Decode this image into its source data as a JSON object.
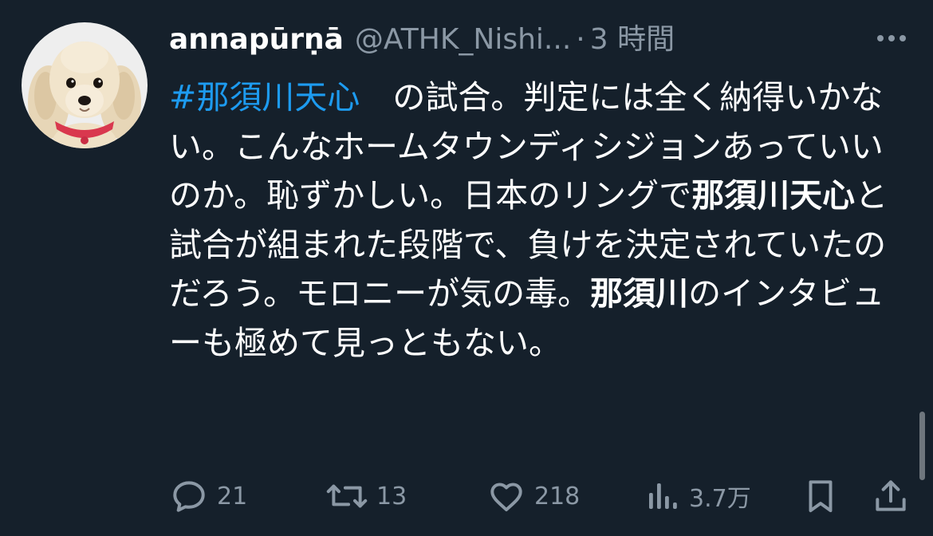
{
  "tweet": {
    "display_name": "annapūrṇā",
    "handle": "@ATHK_Nishi...",
    "dot": "·",
    "time": "3 時間",
    "more_icon": "more-horizontal-icon",
    "body": {
      "hashtag": "#那須川天心",
      "seg1": "　の試合。判定には全く納得いかない。こんなホームタウンディシジョンあっていいのか。恥ずかしい。日本のリングで",
      "bold1": "那須川天心",
      "seg2": "と試合が組まれた段階で、負けを決定されていたのだろう。モロニーが気の毒。",
      "bold2": "那須川",
      "seg3": "のインタビューも極めて見っともない。"
    },
    "actions": {
      "reply_count": "21",
      "retweet_count": "13",
      "like_count": "218",
      "views_count": "3.7万"
    }
  },
  "colors": {
    "background": "#15202b",
    "text": "#ffffff",
    "secondary": "#8b98a5",
    "link": "#1d9bf0"
  }
}
